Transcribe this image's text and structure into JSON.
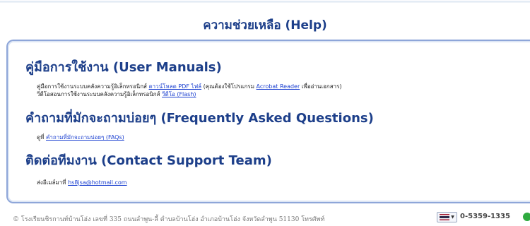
{
  "page": {
    "title": "ความช่วยเหลือ (Help)"
  },
  "manuals": {
    "heading": "คู่มือการใช้งาน (User Manuals)",
    "line1_prefix": "คู่มือการใช้งานระบบคลังความรู้อิเล็กทรอนิกส์",
    "line1_link": "ดาวน์โหลด PDF ไฟล์",
    "line1_middle": "(คุณต้องใช้โปรแกรม",
    "line1_link2": "Acrobat Reader",
    "line1_suffix": "เพื่ออ่านเอกสาร)",
    "line2_prefix": "วีดีโอสอนการใช้งานระบบคลังความรู้อิเล็กทรอนิกส์",
    "line2_link": "วีดีโอ (Flash)"
  },
  "faq": {
    "heading": "คำถามที่มักจะถามบ่อยๆ (Frequently Asked Questions)",
    "prefix": "ดูที่",
    "link": "คำถามที่มักจะถามบ่อยๆ (FAQs)"
  },
  "contact": {
    "heading": "ติดต่อทีมงาน (Contact Support Team)",
    "prefix": "ส่งอีเมล์มาที่",
    "email": "hs8jsa@hotmail.com"
  },
  "footer": {
    "text": "© โรงเรียนชิรกานท์บ้านโฮ่ง เลขที่ 335 ถนนลำพูน-ลี้ ตำบลบ้านโฮ่ง อำเภอบ้านโฮ่ง จังหวัดลำพูน 51130 โทรศัพท์",
    "phone": "0-5359-1335"
  },
  "icons": {
    "flag": "thai-flag-icon",
    "caret": "chevron-down-icon",
    "phone": "phone-icon"
  },
  "colors": {
    "heading": "#1d3f8a",
    "link": "#1a3fd0",
    "panel_border": "#8ea6d9"
  }
}
